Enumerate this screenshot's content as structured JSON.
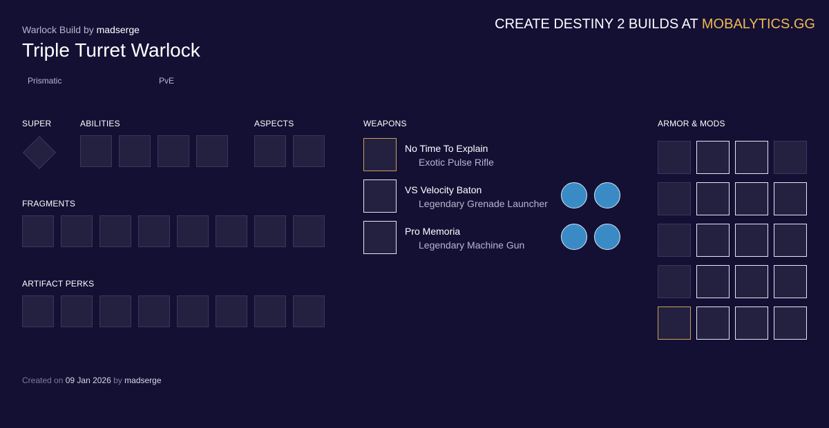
{
  "header": {
    "build_prefix": "Warlock Build by",
    "author": "madserge",
    "title": "Triple Turret Warlock",
    "tags": [
      "Prismatic",
      "PvE"
    ]
  },
  "promo": {
    "prefix": "CREATE DESTINY 2 BUILDS AT",
    "brand": "MOBALYTICS.GG"
  },
  "sections": {
    "super": "SUPER",
    "abilities": "ABILITIES",
    "aspects": "ASPECTS",
    "fragments": "FRAGMENTS",
    "artifact_perks": "ARTIFACT PERKS",
    "weapons": "WEAPONS",
    "armor_mods": "ARMOR & MODS"
  },
  "weapons": [
    {
      "name": "No Time To Explain",
      "type": "Exotic Pulse Rifle"
    },
    {
      "name": "VS Velocity Baton",
      "type": "Legendary Grenade Launcher"
    },
    {
      "name": "Pro Memoria",
      "type": "Legendary Machine Gun"
    }
  ],
  "footer": {
    "created_on": "Created on",
    "date": "09 Jan 2026",
    "by": "by",
    "author": "madserge"
  },
  "colors": {
    "background": "#141034",
    "brand_accent": "#f0b856",
    "exotic_border": "#c9a253",
    "perk_fill": "#3a8bc5"
  }
}
